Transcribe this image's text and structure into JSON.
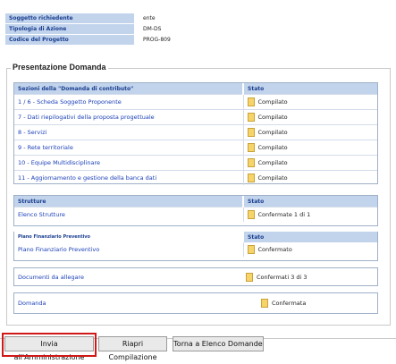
{
  "request_info": {
    "rows": [
      {
        "label": "Soggetto richiedente",
        "value": "ente"
      },
      {
        "label": "Tipologia di Azione",
        "value": "DM-DS"
      },
      {
        "label": "Codice del Progetto",
        "value": "PROG-809"
      }
    ]
  },
  "presentation": {
    "legend": "Presentazione Domanda",
    "sections": {
      "header_name": "Sezioni della \"Domanda di contributo\"",
      "header_status": "Stato",
      "rows": [
        {
          "name": "1 / 6 - Scheda Soggetto Proponente",
          "status": "Compilato"
        },
        {
          "name": "7 - Dati riepilogativi della proposta progettuale",
          "status": "Compilato"
        },
        {
          "name": "8 - Servizi",
          "status": "Compilato"
        },
        {
          "name": "9 - Rete territoriale",
          "status": "Compilato"
        },
        {
          "name": "10 - Equipe Multidisciplinare",
          "status": "Compilato"
        },
        {
          "name": "11 - Aggiornamento e gestione della banca dati",
          "status": "Compilato"
        }
      ]
    },
    "structures": {
      "header_name": "Strutture",
      "header_status": "Stato",
      "row": {
        "name": "Elenco Strutture",
        "status": "Confermate 1 di 1"
      }
    },
    "financial_plan": {
      "header_name": "Piano Finanziario Preventivo",
      "header_status": "Stato",
      "row": {
        "name": "Piano Finanziario Preventivo",
        "status": "Confermato"
      }
    },
    "documents": {
      "name": "Documenti da allegare",
      "status": "Confermati 3 di 3"
    },
    "application": {
      "name": "Domanda",
      "status": "Confermata"
    }
  },
  "buttons": {
    "send": "Invia all'Amministrazione",
    "reopen": "Riapri Compilazione",
    "back": "Torna a Elenco Domande"
  },
  "colors": {
    "header_bg": "#c2d3ec",
    "link": "#1a3fb8",
    "highlight": "#d01818"
  }
}
